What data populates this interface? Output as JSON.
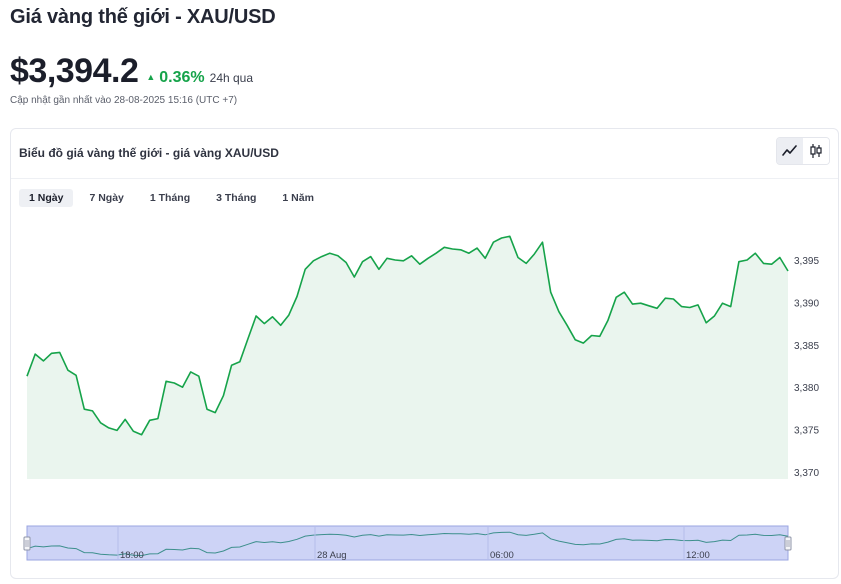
{
  "header": {
    "title": "Giá vàng thế giới - XAU/USD",
    "price": "$3,394.2",
    "change": "0.36%",
    "change_period": "24h qua",
    "updated": "Cập nhật gần nhất vào 28-08-2025 15:16 (UTC +7)"
  },
  "card": {
    "title": "Biểu đồ giá vàng thế giới - giá vàng XAU/USD",
    "chart_types": [
      {
        "icon": "line-chart-icon",
        "active": true
      },
      {
        "icon": "candlestick-chart-icon",
        "active": false
      }
    ],
    "ranges": [
      {
        "label": "1 Ngày",
        "active": true
      },
      {
        "label": "7 Ngày",
        "active": false
      },
      {
        "label": "1 Tháng",
        "active": false
      },
      {
        "label": "3 Tháng",
        "active": false
      },
      {
        "label": "1 Năm",
        "active": false
      }
    ]
  },
  "colors": {
    "line": "#16a34a",
    "area": "#eaf5ee",
    "navigator_fill": "#cdd3f6",
    "accent_up": "#16a34a"
  },
  "chart_data": {
    "type": "area",
    "title": "",
    "xlabel": "",
    "ylabel": "",
    "ylim": [
      3370,
      3397.5
    ],
    "yticks": [
      "3,370",
      "3,375",
      "3,380",
      "3,385",
      "3,390",
      "3,395"
    ],
    "ytick_values": [
      3370,
      3375,
      3380,
      3385,
      3390,
      3395
    ],
    "navigator_labels": [
      "18:00",
      "28 Aug",
      "06:00",
      "12:00"
    ],
    "series": [
      {
        "values": [
          3381.3,
          3383.9,
          3383.1,
          3384.0,
          3384.1,
          3382.0,
          3381.4,
          3377.4,
          3377.2,
          3375.8,
          3375.2,
          3374.9,
          3376.2,
          3374.8,
          3374.4,
          3376.1,
          3376.3,
          3380.7,
          3380.5,
          3380.0,
          3381.8,
          3381.3,
          3377.4,
          3377.0,
          3379.0,
          3382.6,
          3383.0,
          3385.7,
          3388.4,
          3387.5,
          3388.3,
          3387.3,
          3388.5,
          3390.7,
          3393.9,
          3394.9,
          3395.4,
          3395.8,
          3395.5,
          3394.7,
          3393.0,
          3394.8,
          3395.4,
          3393.9,
          3395.2,
          3395.0,
          3394.9,
          3395.5,
          3394.5,
          3395.2,
          3395.8,
          3396.5,
          3396.3,
          3396.2,
          3395.8,
          3396.4,
          3395.2,
          3397.1,
          3397.6,
          3397.8,
          3395.3,
          3394.6,
          3395.7,
          3397.1,
          3391.2,
          3388.9,
          3387.3,
          3385.6,
          3385.2,
          3386.1,
          3386.0,
          3387.9,
          3390.6,
          3391.2,
          3389.8,
          3389.9,
          3389.6,
          3389.3,
          3390.5,
          3390.4,
          3389.5,
          3389.4,
          3389.7,
          3387.6,
          3388.4,
          3389.9,
          3389.5,
          3394.8,
          3395.0,
          3395.8,
          3394.6,
          3394.5,
          3395.3,
          3393.7
        ]
      }
    ]
  }
}
